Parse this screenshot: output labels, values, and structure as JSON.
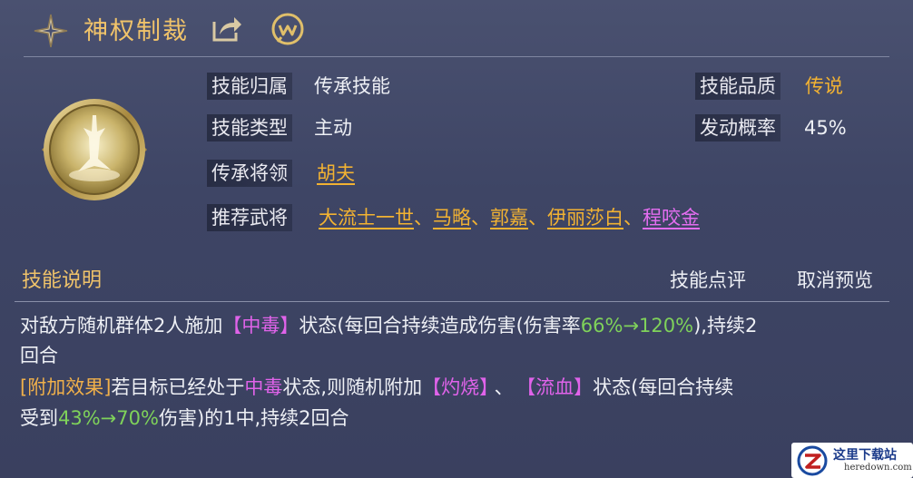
{
  "header": {
    "title": "神权制裁",
    "icons": [
      "sparkle-star-icon",
      "share-icon",
      "wiki-icon"
    ]
  },
  "info": {
    "belong_label": "技能归属",
    "belong_value": "传承技能",
    "type_label": "技能类型",
    "type_value": "主动",
    "heir_label": "传承将领",
    "heir_value": "胡夫",
    "recommend_label": "推荐武将",
    "recommend": [
      "大流士一世",
      "马略",
      "郭嘉",
      "伊丽莎白",
      "程咬金"
    ],
    "separator": "、",
    "quality_label": "技能品质",
    "quality_value": "传说",
    "chance_label": "发动概率",
    "chance_value": "45%"
  },
  "section": {
    "title": "技能说明",
    "review_button": "技能点评",
    "cancel_button": "取消预览"
  },
  "description": {
    "line1_a": "对敌方随机群体2人施加",
    "line1_status": "【中毒】",
    "line1_b": "状态(每回合持续造成伤害(伤害率",
    "line1_rate": "66%→120%",
    "line1_c": "),持续2",
    "line2": "回合",
    "line3_tag": "[附加效果]",
    "line3_a": "若目标已经处于",
    "line3_status": "中毒",
    "line3_b": "状态,则随机附加",
    "line3_s1": "【灼烧】",
    "line3_sep": "、",
    "line3_s2": "【流血】",
    "line3_c": "状态(每回合持续",
    "line4_a": "受到",
    "line4_rate": "43%→70%",
    "line4_b": "伤害)的1中,持续2回合"
  },
  "watermark": {
    "cn": "这里下载站",
    "en": "heredown.com"
  },
  "colors": {
    "title_gold": "#f0c36a",
    "legend_gold": "#f2b232",
    "status_pink": "#e063ea",
    "rate_green": "#7fd25a"
  }
}
